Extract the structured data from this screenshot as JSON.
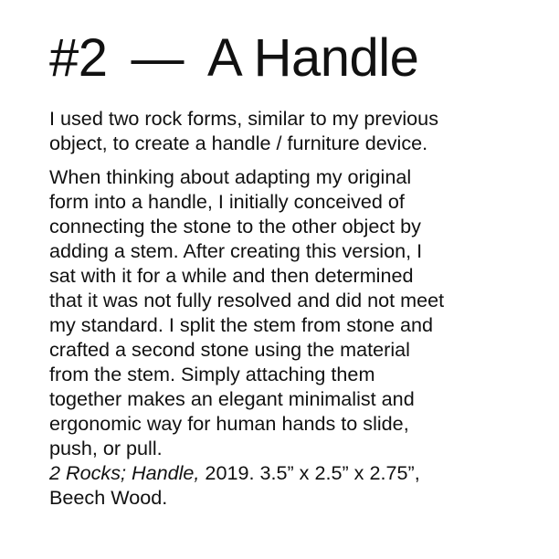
{
  "document": {
    "title_number": "#2",
    "title_dash": "—",
    "title_name": "A Handle",
    "intro_line_1": "I used two rock forms, similar to my previous",
    "intro_line_2": "object, to create a handle / furniture device.",
    "body_lines": [
      "When thinking about adapting my original",
      "form into a handle, I initially conceived of",
      "connecting the stone to the other object by",
      "adding a stem. After creating this version, I",
      "sat with it for a while and then determined",
      "that it was not fully resolved and did not meet",
      "my standard. I split the stem from stone and",
      "crafted a second stone using the material",
      "from the stem. Simply attaching them",
      "together makes an elegant minimalist and",
      "ergonomic way for human hands to slide,",
      "push, or pull."
    ],
    "caption_italic": "2 Rocks; Handle,",
    "caption_rest": " 2019. 3.5” x 2.5” x 2.75”,",
    "caption_line_2": "Beech Wood."
  }
}
